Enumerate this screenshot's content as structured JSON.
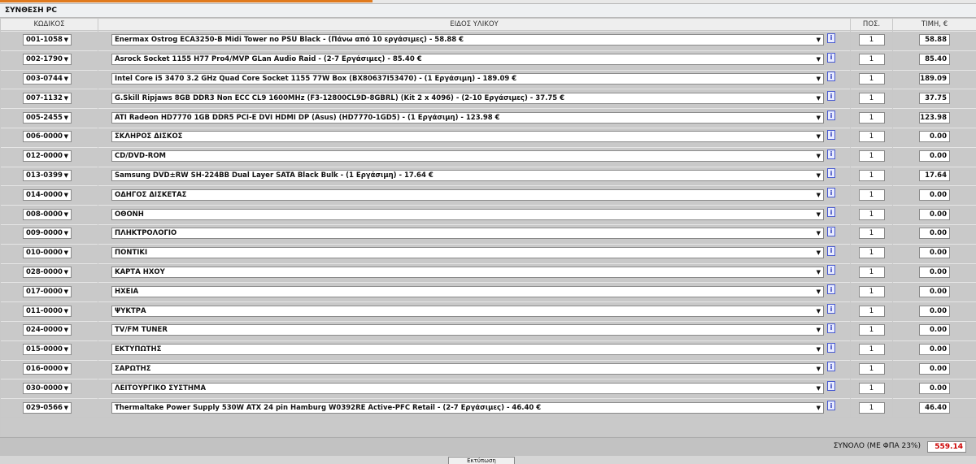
{
  "title": "ΣΥΝΘΕΣΗ PC",
  "columns": {
    "code": "ΚΩΔΙΚΟΣ",
    "item": "ΕΙΔΟΣ ΥΛΙΚΟΥ",
    "qty": "ΠΟΣ.",
    "price": "ΤΙΜΗ, €"
  },
  "info_glyph": "[i]",
  "arrow_glyph": "▼",
  "rows": [
    {
      "code": "001-1058",
      "item": "Enermax Ostrog ECA3250-B Midi Tower no PSU Black - (Πάνω από 10 εργάσιμες) - 58.88 €",
      "qty": "1",
      "price": "58.88"
    },
    {
      "code": "002-1790",
      "item": "Asrock Socket 1155 H77 Pro4/MVP GLan Audio Raid - (2-7 Εργάσιμες) - 85.40 €",
      "qty": "1",
      "price": "85.40"
    },
    {
      "code": "003-0744",
      "item": "Intel Core i5 3470 3.2 GHz Quad Core Socket 1155 77W Box (BX80637I53470) - (1 Εργάσιμη) - 189.09 €",
      "qty": "1",
      "price": "189.09"
    },
    {
      "code": "007-1132",
      "item": "G.Skill Ripjaws 8GB DDR3 Non ECC CL9 1600MHz (F3-12800CL9D-8GBRL) (Kit 2 x 4096) - (2-10 Εργάσιμες) - 37.75 €",
      "qty": "1",
      "price": "37.75"
    },
    {
      "code": "005-2455",
      "item": "ATI Radeon HD7770 1GB DDR5 PCI-E DVI HDMI DP (Asus) (HD7770-1GD5) - (1 Εργάσιμη) - 123.98 €",
      "qty": "1",
      "price": "123.98"
    },
    {
      "code": "006-0000",
      "item": "ΣΚΛΗΡΟΣ ΔΙΣΚΟΣ",
      "qty": "1",
      "price": "0.00"
    },
    {
      "code": "012-0000",
      "item": "CD/DVD-ROM",
      "qty": "1",
      "price": "0.00"
    },
    {
      "code": "013-0399",
      "item": "Samsung DVD±RW SH-224BB Dual Layer SATA Black Bulk - (1 Εργάσιμη) - 17.64 €",
      "qty": "1",
      "price": "17.64"
    },
    {
      "code": "014-0000",
      "item": "ΟΔΗΓΟΣ ΔΙΣΚΕΤΑΣ",
      "qty": "1",
      "price": "0.00"
    },
    {
      "code": "008-0000",
      "item": "ΟΘΟΝΗ",
      "qty": "1",
      "price": "0.00"
    },
    {
      "code": "009-0000",
      "item": "ΠΛΗΚΤΡΟΛΟΓΙΟ",
      "qty": "1",
      "price": "0.00"
    },
    {
      "code": "010-0000",
      "item": "ΠΟΝΤΙΚΙ",
      "qty": "1",
      "price": "0.00"
    },
    {
      "code": "028-0000",
      "item": "ΚΑΡΤΑ ΗΧΟΥ",
      "qty": "1",
      "price": "0.00"
    },
    {
      "code": "017-0000",
      "item": "ΗΧΕΙΑ",
      "qty": "1",
      "price": "0.00"
    },
    {
      "code": "011-0000",
      "item": "ΨΥΚΤΡΑ",
      "qty": "1",
      "price": "0.00"
    },
    {
      "code": "024-0000",
      "item": "TV/FM TUNER",
      "qty": "1",
      "price": "0.00"
    },
    {
      "code": "015-0000",
      "item": "ΕΚΤΥΠΩΤΗΣ",
      "qty": "1",
      "price": "0.00"
    },
    {
      "code": "016-0000",
      "item": "ΣΑΡΩΤΗΣ",
      "qty": "1",
      "price": "0.00"
    },
    {
      "code": "030-0000",
      "item": "ΛΕΙΤΟΥΡΓΙΚΟ ΣΥΣΤΗΜΑ",
      "qty": "1",
      "price": "0.00"
    },
    {
      "code": "029-0566",
      "item": "Thermaltake Power Supply 530W ATX 24 pin Hamburg W0392RE Active-PFC Retail - (2-7 Εργάσιμες) - 46.40 €",
      "qty": "1",
      "price": "46.40"
    }
  ],
  "total": {
    "label": "ΣΥΝΟΛΟ (ΜΕ ΦΠΑ 23%)",
    "value": "559.14"
  },
  "bottom_button": "Εκτύπωση"
}
